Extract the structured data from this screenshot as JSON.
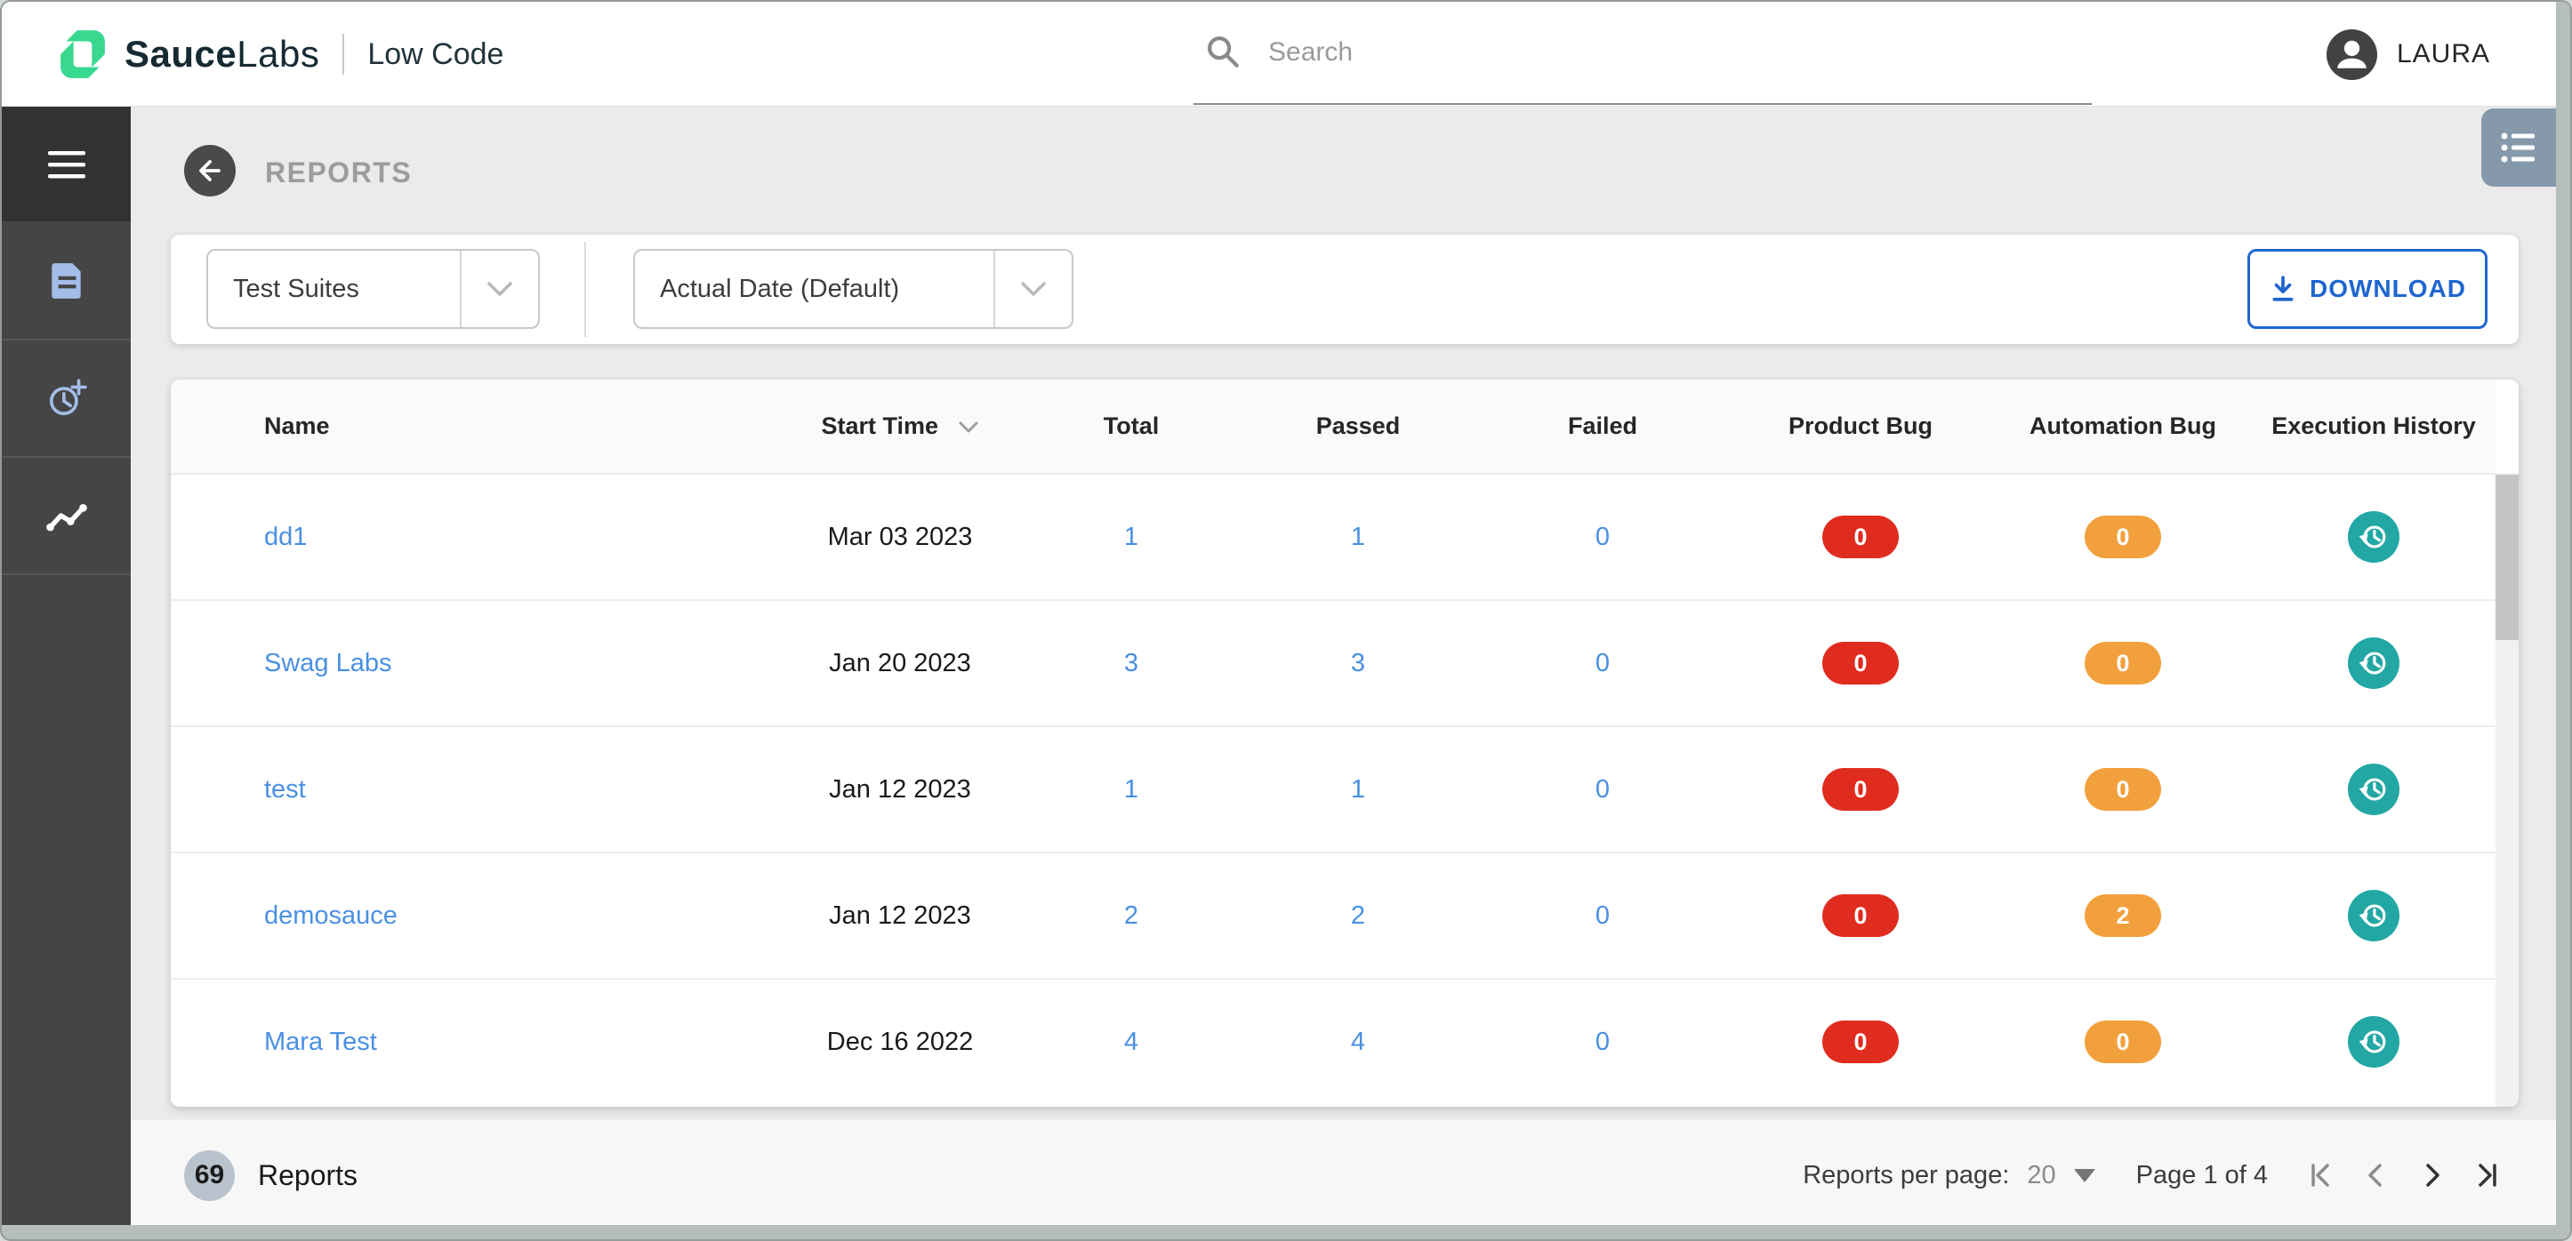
{
  "topbar": {
    "brand_bold": "Sauce",
    "brand_light": "Labs",
    "product": "Low Code",
    "search": {
      "placeholder": "Search"
    },
    "user": {
      "name": "LAURA"
    }
  },
  "sidebar": {
    "items": [
      {
        "icon": "hamburger-menu"
      },
      {
        "icon": "report-document"
      },
      {
        "icon": "schedule-clock-plus"
      },
      {
        "icon": "analytics-trend",
        "active": true
      }
    ]
  },
  "page": {
    "title": "REPORTS",
    "filters": {
      "suite": "Test Suites",
      "date": "Actual Date (Default)"
    },
    "download_label": "DOWNLOAD"
  },
  "table": {
    "columns": [
      "Name",
      "Start Time",
      "Total",
      "Passed",
      "Failed",
      "Product Bug",
      "Automation Bug",
      "Execution History"
    ],
    "rows": [
      {
        "name": "dd1",
        "start_time": "Mar 03 2023",
        "total": "1",
        "passed": "1",
        "failed": "0",
        "product_bug": "0",
        "automation_bug": "0"
      },
      {
        "name": "Swag Labs",
        "start_time": "Jan 20 2023",
        "total": "3",
        "passed": "3",
        "failed": "0",
        "product_bug": "0",
        "automation_bug": "0"
      },
      {
        "name": "test",
        "start_time": "Jan 12 2023",
        "total": "1",
        "passed": "1",
        "failed": "0",
        "product_bug": "0",
        "automation_bug": "0"
      },
      {
        "name": "demosauce",
        "start_time": "Jan 12 2023",
        "total": "2",
        "passed": "2",
        "failed": "0",
        "product_bug": "0",
        "automation_bug": "2"
      },
      {
        "name": "Mara Test",
        "start_time": "Dec 16 2022",
        "total": "4",
        "passed": "4",
        "failed": "0",
        "product_bug": "0",
        "automation_bug": "0"
      }
    ]
  },
  "footer": {
    "count": "69",
    "count_label": "Reports",
    "per_page_label": "Reports per page:",
    "per_page_value": "20",
    "page_status": "Page 1 of 4"
  },
  "icons": {
    "search": "magnifier",
    "user": "person-avatar",
    "back": "arrow-left-circle",
    "download": "arrow-down-tray",
    "sort": "chevron-down",
    "execution_history": "clock-history",
    "view_toggle": "bulleted-list",
    "pagination": [
      "first-page",
      "previous-page",
      "next-page",
      "last-page"
    ]
  },
  "colors": {
    "brand_green": "#38d88f",
    "link_blue": "#4a90e2",
    "download_blue": "#1f66cf",
    "badge_red": "#e02b1f",
    "badge_orange": "#f2a03d",
    "history_teal": "#22a7a4",
    "sidebar_icon_blue": "#a4bde8",
    "footer_badge_gray": "#b9c3cd"
  }
}
